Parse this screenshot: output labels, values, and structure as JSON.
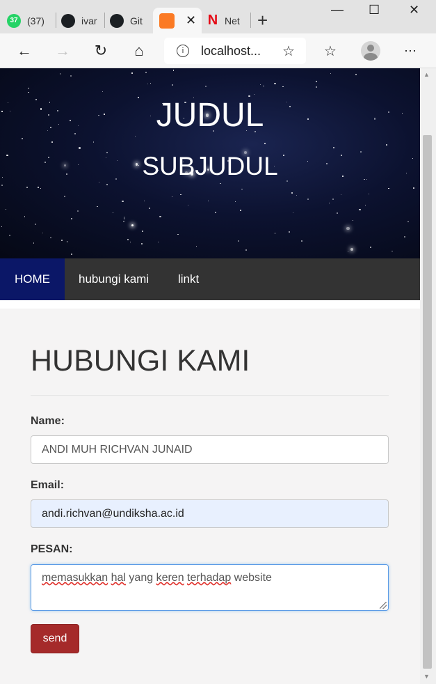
{
  "browser": {
    "tabs": [
      {
        "label": "(37)",
        "badge": "37",
        "icon": "whatsapp-icon"
      },
      {
        "label": "ivar",
        "icon": "github-icon"
      },
      {
        "label": "Git",
        "icon": "github-icon"
      },
      {
        "label": "",
        "icon": "xampp-icon",
        "active": true
      },
      {
        "label": "Net",
        "icon": "netflix-icon"
      }
    ],
    "newtab": "+",
    "address": "localhost...",
    "controls": {
      "minimize": "—",
      "maximize": "☐",
      "close": "✕"
    }
  },
  "hero": {
    "title": "JUDUL",
    "subtitle": "SUBJUDUL"
  },
  "nav": {
    "items": [
      {
        "label": "HOME",
        "active": true
      },
      {
        "label": "hubungi kami"
      },
      {
        "label": "linkt"
      }
    ]
  },
  "form": {
    "title": "HUBUNGI KAMI",
    "name_label": "Name:",
    "name_value": "ANDI MUH RICHVAN JUNAID",
    "email_label": "Email:",
    "email_value": "andi.richvan@undiksha.ac.id",
    "message_label": "PESAN:",
    "message_words": [
      "memasukkan",
      " ",
      "hal",
      " yang ",
      "keren",
      " ",
      "terhadap",
      " website"
    ],
    "send_label": "send"
  },
  "colors": {
    "nav_bg": "#333333",
    "nav_active": "#0b1767",
    "send_button": "#a52a2a",
    "autofill_bg": "#e8f0fe"
  }
}
